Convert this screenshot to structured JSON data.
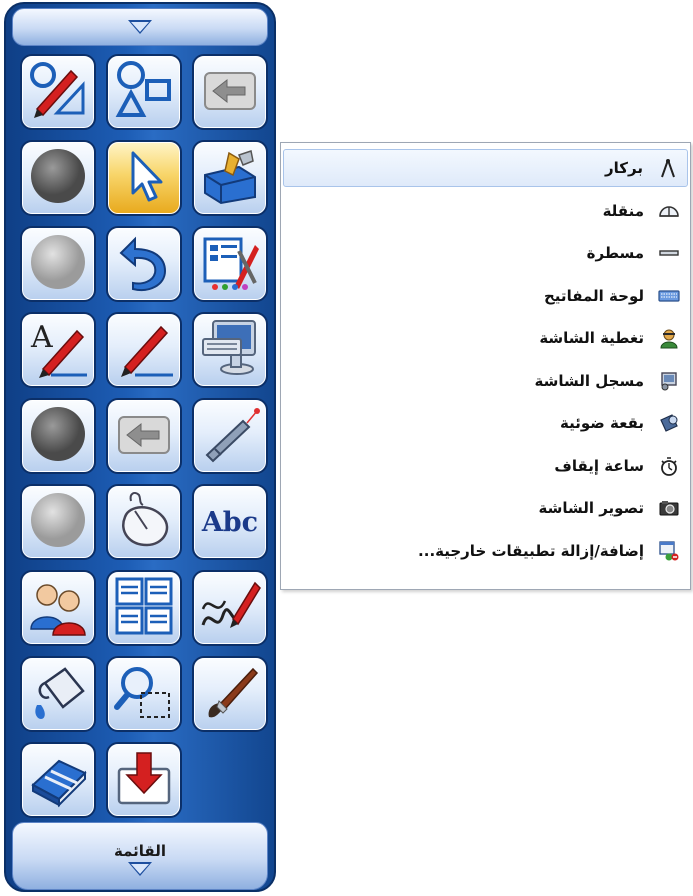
{
  "toolbar": {
    "menu_label": "القائمة",
    "buttons": [
      {
        "icon": "pen-ruler-icon",
        "active": false
      },
      {
        "icon": "shapes-icon",
        "active": false
      },
      {
        "icon": "arrow-left-icon",
        "active": false
      },
      {
        "icon": "circle-gray-icon",
        "active": false
      },
      {
        "icon": "pointer-icon",
        "active": true
      },
      {
        "icon": "toolbox-icon",
        "active": false
      },
      {
        "icon": "circle-light-icon",
        "active": false
      },
      {
        "icon": "undo-icon",
        "active": false
      },
      {
        "icon": "settings-icon",
        "active": false
      },
      {
        "icon": "text-pen-icon",
        "active": false
      },
      {
        "icon": "red-pen-icon",
        "active": false
      },
      {
        "icon": "computer-keyboard-icon",
        "active": false
      },
      {
        "icon": "circle-gray-icon",
        "active": false
      },
      {
        "icon": "arrow-left-icon",
        "active": false
      },
      {
        "icon": "laser-pointer-icon",
        "active": false
      },
      {
        "icon": "circle-light-icon",
        "active": false
      },
      {
        "icon": "mouse-icon",
        "active": false
      },
      {
        "icon": "abc-text-icon",
        "active": false,
        "text": "Abc"
      },
      {
        "icon": "users-icon",
        "active": false
      },
      {
        "icon": "pages-icon",
        "active": false
      },
      {
        "icon": "signature-pen-icon",
        "active": false
      },
      {
        "icon": "paint-bucket-icon",
        "active": false
      },
      {
        "icon": "magnifier-select-icon",
        "active": false
      },
      {
        "icon": "paintbrush-icon",
        "active": false
      },
      {
        "icon": "eraser-icon",
        "active": false
      },
      {
        "icon": "download-icon",
        "active": false
      }
    ]
  },
  "menu": {
    "items": [
      {
        "label": "بركار",
        "icon": "compass-icon",
        "highlighted": true
      },
      {
        "label": "منقلة",
        "icon": "protractor-icon"
      },
      {
        "label": "مسطرة",
        "icon": "ruler-icon"
      },
      {
        "label": "لوحة المفاتيح",
        "icon": "keyboard-icon"
      },
      {
        "label": "تغطية الشاشة",
        "icon": "screen-cover-icon"
      },
      {
        "label": "مسجل الشاشة",
        "icon": "screen-recorder-icon"
      },
      {
        "label": "بقعة ضوئية",
        "icon": "spotlight-icon"
      },
      {
        "label": "ساعة إيقاف",
        "icon": "stopwatch-icon"
      },
      {
        "label": "تصوير الشاشة",
        "icon": "camera-icon"
      },
      {
        "label": "إضافة/إزالة تطبيقات خارجية...",
        "icon": "add-remove-apps-icon"
      }
    ]
  },
  "colors": {
    "toolbar_blue": "#1d5db5",
    "active_button": "#f8d56a",
    "pen_red": "#d42020",
    "menu_highlight": "#dfeafa"
  }
}
